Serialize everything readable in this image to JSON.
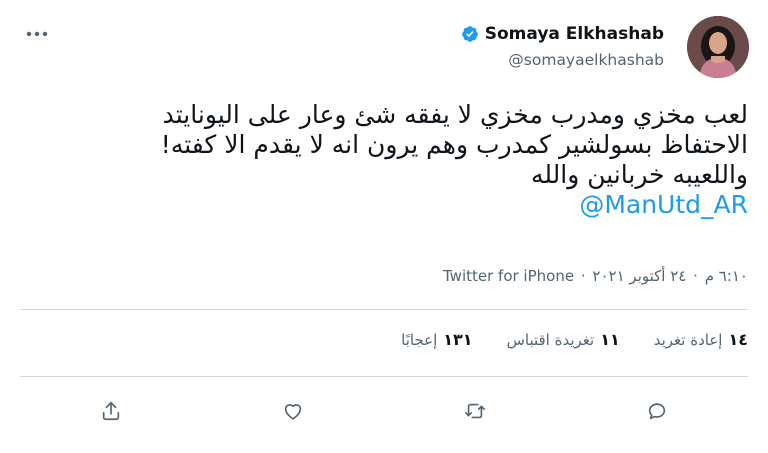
{
  "tweet": {
    "author_name": "Somaya Elkhashab",
    "author_handle": "@somayaelkhashab",
    "text_lines": [
      "لعب مخزي ومدرب مخزي لا يفقه شئ وعار على اليونايتد",
      "الاحتفاظ بسولشير كمدرب وهم يرون انه لا يقدم الا كفته!",
      "واللعيبه خربانين والله"
    ],
    "mention": "@ManUtd_AR",
    "time": "٦:١٠ م",
    "date": "٢٤ أكتوبر ٢٠٢١",
    "separator": "·",
    "source": "Twitter for iPhone"
  },
  "stats": {
    "retweets_count": "١٤",
    "retweets_label": "إعادة تغريد",
    "quotes_count": "١١",
    "quotes_label": "تغريدة اقتباس",
    "likes_count": "١٣١",
    "likes_label": "إعجابًا"
  },
  "icons": {
    "verified": "verified-badge-icon",
    "more": "more-dots-icon",
    "reply": "reply-icon",
    "retweet": "retweet-icon",
    "like": "heart-icon",
    "share": "share-icon"
  },
  "colors": {
    "accent": "#1d9bf0",
    "text": "#0f1419",
    "secondary": "#536471",
    "border": "#cfd9de"
  }
}
